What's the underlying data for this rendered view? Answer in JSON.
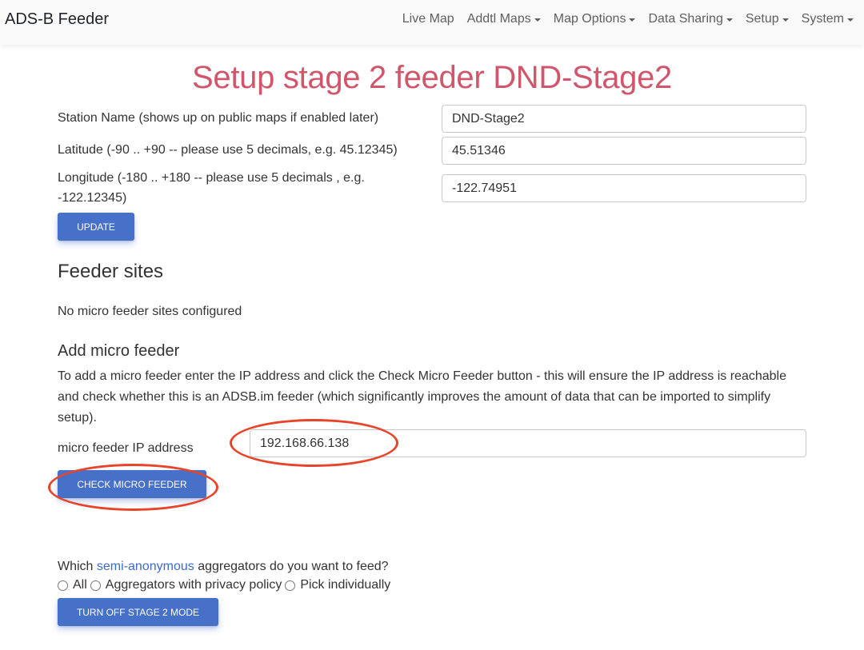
{
  "navbar": {
    "brand": "ADS-B Feeder",
    "items": [
      {
        "label": "Live Map",
        "dropdown": false
      },
      {
        "label": "Addtl Maps",
        "dropdown": true
      },
      {
        "label": "Map Options",
        "dropdown": true
      },
      {
        "label": "Data Sharing",
        "dropdown": true
      },
      {
        "label": "Setup",
        "dropdown": true
      },
      {
        "label": "System",
        "dropdown": true
      }
    ]
  },
  "page": {
    "title": "Setup stage 2 feeder DND-Stage2",
    "title_color": "#d0576b"
  },
  "station_form": {
    "station_name_label": "Station Name (shows up on public maps if enabled later)",
    "station_name_value": "DND-Stage2",
    "latitude_label": "Latitude (-90 .. +90 -- please use 5 decimals, e.g. 45.12345)",
    "latitude_value": "45.51346",
    "longitude_label_line1": "Longitude (-180 .. +180 -- please use 5 decimals , e.g.",
    "longitude_label_line2": "-122.12345)",
    "longitude_value": "-122.74951",
    "update_button": "Update"
  },
  "feeder_sites": {
    "heading": "Feeder sites",
    "empty_message": "No micro feeder sites configured"
  },
  "add_micro_feeder": {
    "heading": "Add micro feeder",
    "description": "To add a micro feeder enter the IP address and click the Check Micro Feeder button - this will ensure the IP address is reachable and check whether this is an ADSB.im feeder (which significantly improves the amount of data that can be imported to simplify setup).",
    "ip_label": "micro feeder IP address",
    "ip_value": "192.168.66.138",
    "check_button": "Check Micro Feeder"
  },
  "aggregators": {
    "question_prefix": "Which",
    "question_link": "semi-anonymous",
    "question_suffix": "aggregators do you want to feed?",
    "options": [
      {
        "label": "All",
        "selected": false
      },
      {
        "label": "Aggregators with privacy policy",
        "selected": false
      },
      {
        "label": "Pick individually",
        "selected": false
      }
    ],
    "turn_off_button": "Turn off stage 2 mode"
  },
  "colors": {
    "primary_button": "#4770c8",
    "link": "#3b6ac9",
    "annotation": "#e8442a"
  }
}
